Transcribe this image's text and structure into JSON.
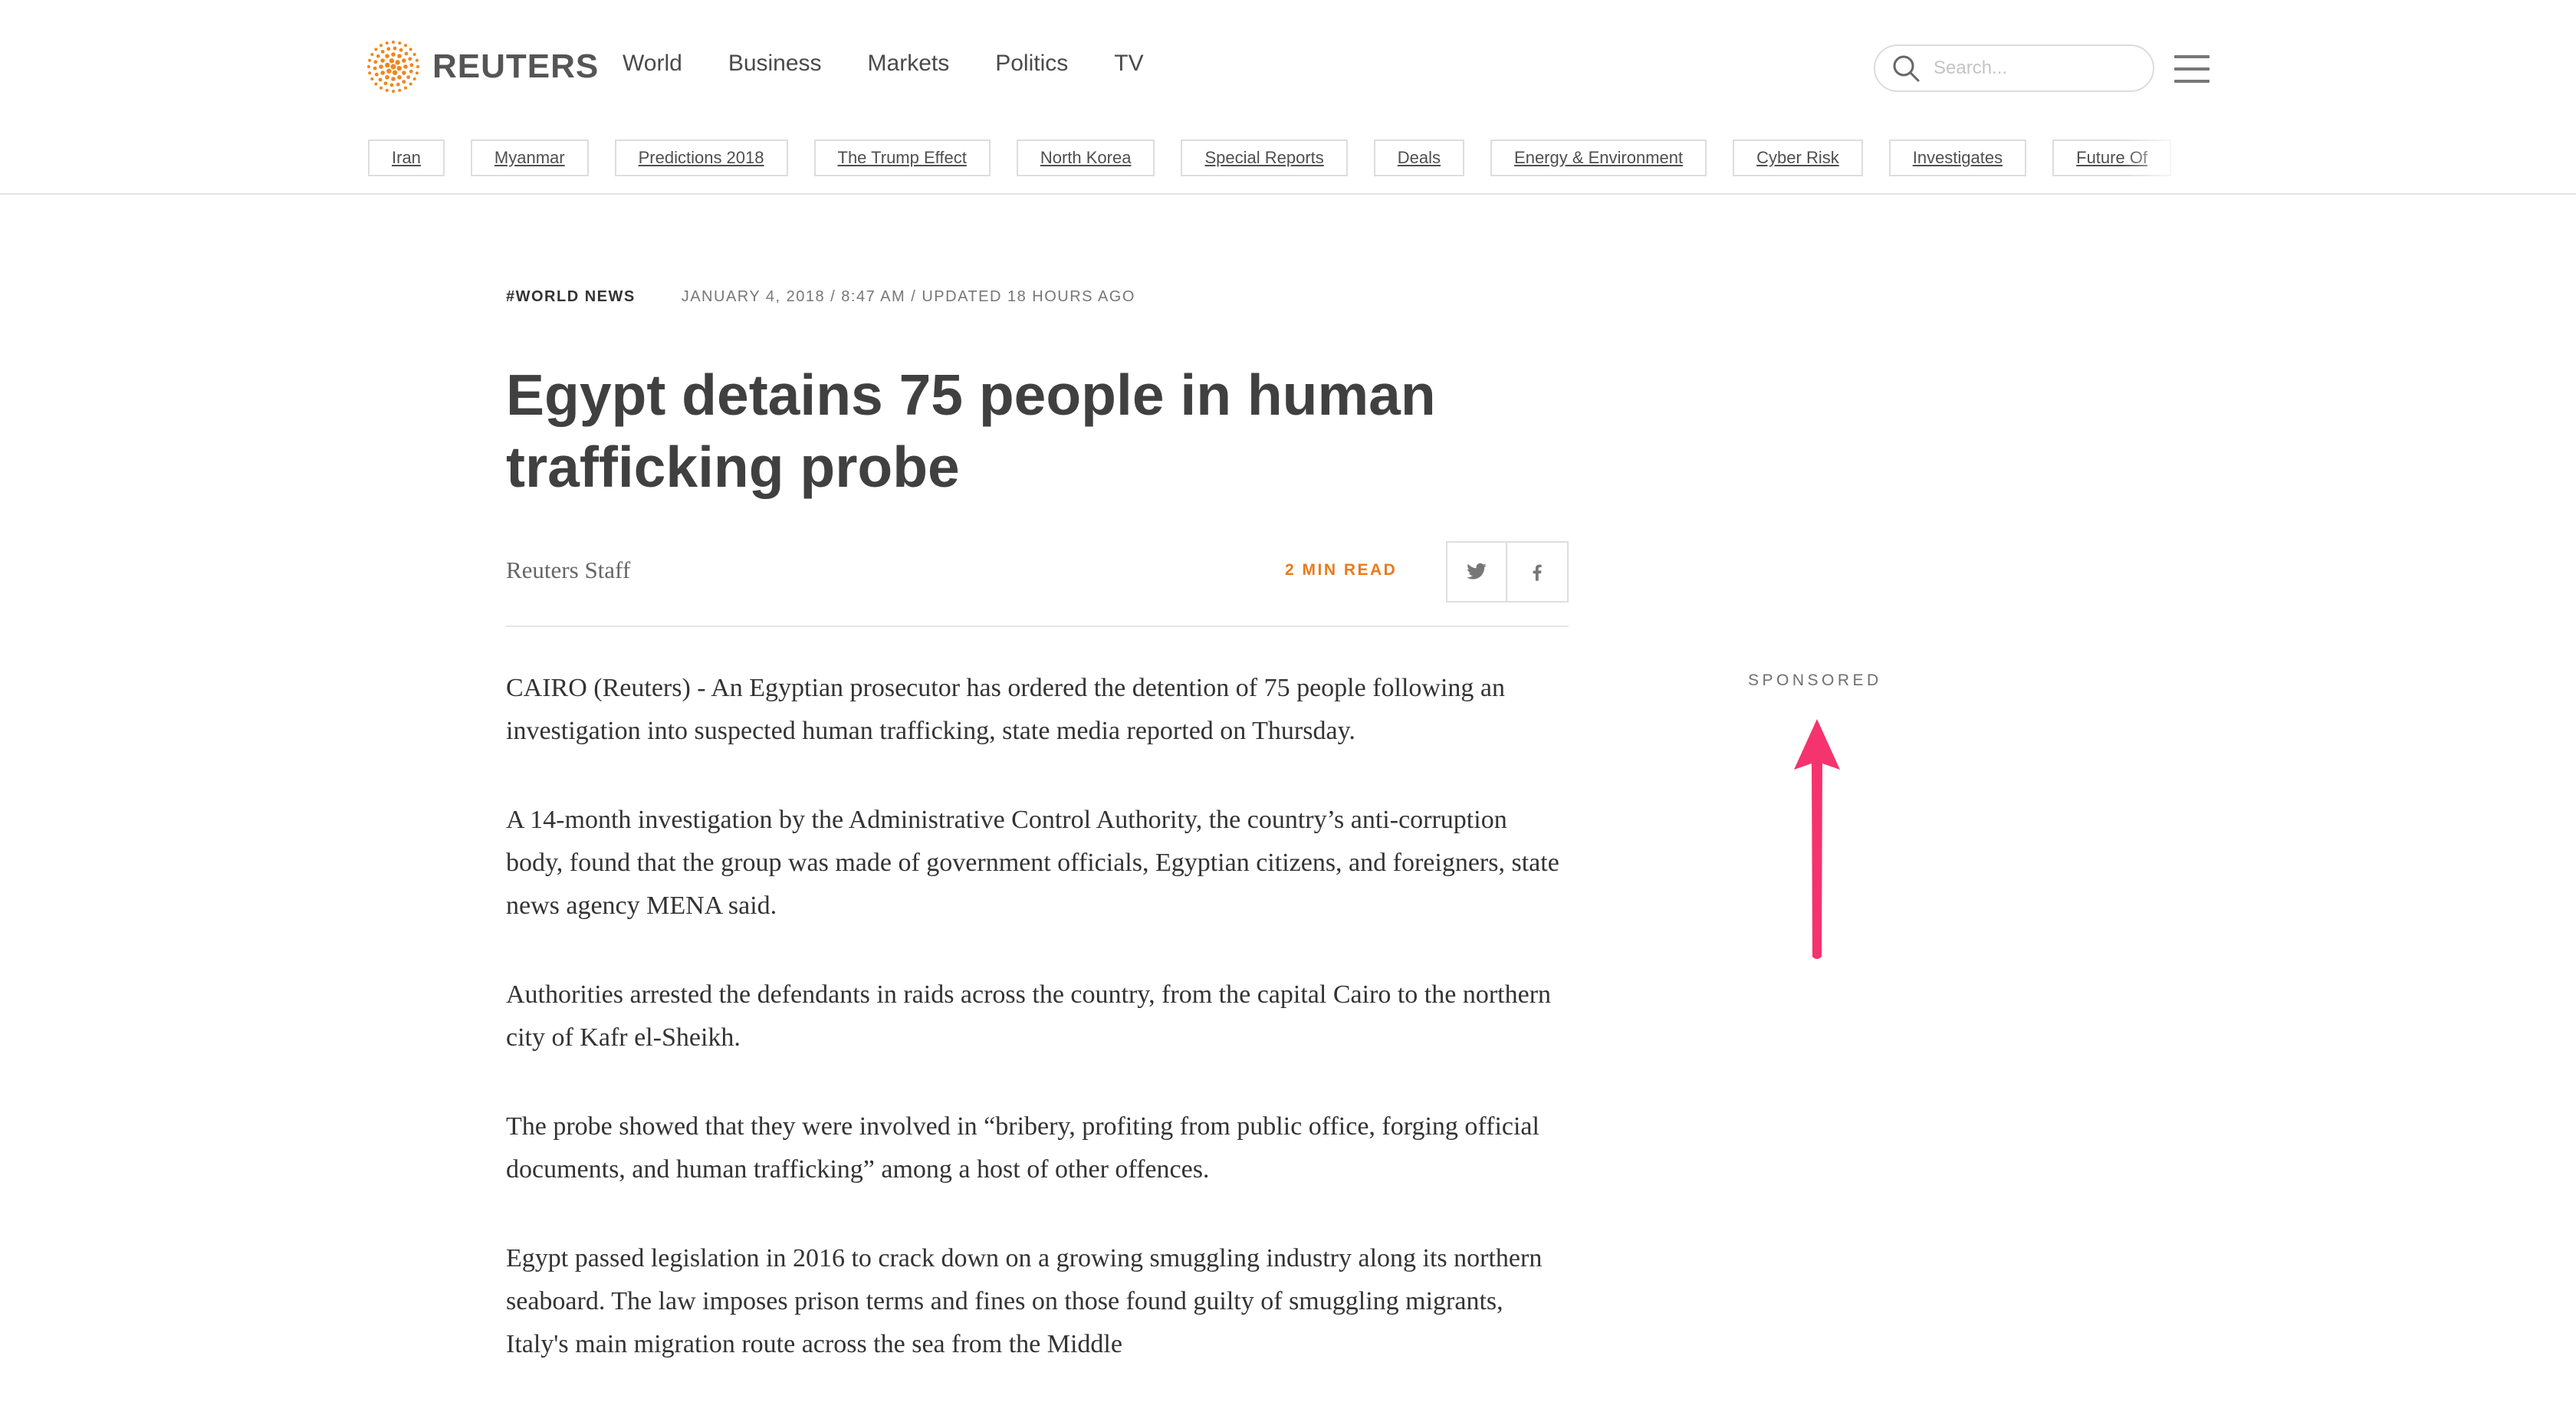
{
  "header": {
    "brand": "REUTERS",
    "nav": [
      "World",
      "Business",
      "Markets",
      "Politics",
      "TV"
    ],
    "search_placeholder": "Search...",
    "topics": [
      "Iran",
      "Myanmar",
      "Predictions 2018",
      "The Trump Effect",
      "North Korea",
      "Special Reports",
      "Deals",
      "Energy & Environment",
      "Cyber Risk",
      "Investigates",
      "Future Of"
    ]
  },
  "article": {
    "section": "#WORLD NEWS",
    "dateline": "JANUARY 4, 2018 / 8:47 AM / UPDATED 18 HOURS AGO",
    "headline": "Egypt detains 75 people in human trafficking probe",
    "author": "Reuters Staff",
    "read_time": "2 MIN READ",
    "paragraphs": [
      "CAIRO (Reuters) - An Egyptian prosecutor has ordered the detention of 75 people following an investigation into suspected human trafficking, state media reported on Thursday.",
      "A 14-month investigation by the Administrative Control Authority, the country’s anti-corruption body, found that the group was made of government officials, Egyptian citizens, and foreigners, state news agency MENA said.",
      "Authorities arrested the defendants in raids across the country, from the capital Cairo to the northern city of Kafr el-Sheikh.",
      "The probe showed that they were involved in “bribery, profiting from public office, forging official documents, and human trafficking” among a host of other offences.",
      "Egypt passed legislation in 2016 to crack down on a growing smuggling industry along its northern seaboard. The law imposes prison terms and fines on those found guilty of smuggling migrants, Italy's main migration route across the sea from the Middle"
    ]
  },
  "sidebar": {
    "sponsored_label": "SPONSORED"
  },
  "colors": {
    "brand_orange": "#ea7a1b",
    "annotation_arrow": "#f5336e"
  },
  "icons": [
    "reuters-logo-icon",
    "search-icon",
    "hamburger-menu-icon",
    "twitter-icon",
    "facebook-icon",
    "annotation-arrow-icon"
  ]
}
